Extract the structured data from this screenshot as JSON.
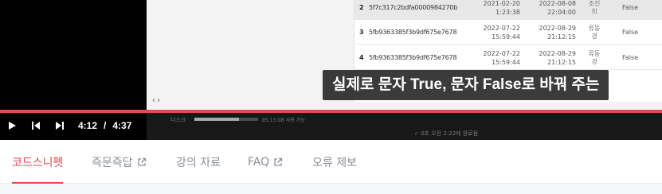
{
  "video": {
    "code_hint": "‹›",
    "table_rows": [
      {
        "index": "2",
        "id": "5f7c317c2bdfa0000984270b",
        "date1_line1": "2021-02-20",
        "date1_line2": "1:23:38",
        "date2_line1": "2022-08-08",
        "date2_line2": "22:04:00",
        "name_line1": "조진",
        "name_line2": "희",
        "bool": "False"
      },
      {
        "index": "3",
        "id": "5fb9363385f3b9df675e7678",
        "date1_line1": "2022-07-22",
        "date1_line2": "15:59:44",
        "date2_line1": "2022-08-29",
        "date2_line2": "21:12:15",
        "name_line1": "류동",
        "name_line2": "경",
        "bool": "False"
      },
      {
        "index": "4",
        "id": "5fb9363385f3b9df675e7678",
        "date1_line1": "2022-07-22",
        "date1_line2": "15:59:44",
        "date2_line1": "2022-08-29",
        "date2_line2": "21:12:15",
        "name_line1": "류동",
        "name_line2": "경",
        "bool": "False"
      }
    ],
    "subtitle": "실제로 문자 True, 문자 False로 바꿔 주는",
    "background_status": {
      "disk_label": "디스크",
      "free_text": "85.13 GB 사용 가능",
      "done_text": "✓ 0초   오전 2:22에 완료됨"
    },
    "progress_fraction": 1.0
  },
  "player": {
    "current_time": "4:12",
    "separator": "/",
    "duration": "4:37",
    "icons": [
      "play-icon",
      "skip-previous-icon",
      "skip-next-icon"
    ]
  },
  "tabs": [
    {
      "label": "코드스니펫",
      "active": true,
      "external": false
    },
    {
      "label": "즉문즉답",
      "active": false,
      "external": true
    },
    {
      "label": "강의 자료",
      "active": false,
      "external": false
    },
    {
      "label": "FAQ",
      "active": false,
      "external": true
    },
    {
      "label": "오류 제보",
      "active": false,
      "external": false
    }
  ],
  "colors": {
    "accent": "#e5484d",
    "progress": "#d94f55",
    "tab_inactive": "#8a8f99"
  }
}
